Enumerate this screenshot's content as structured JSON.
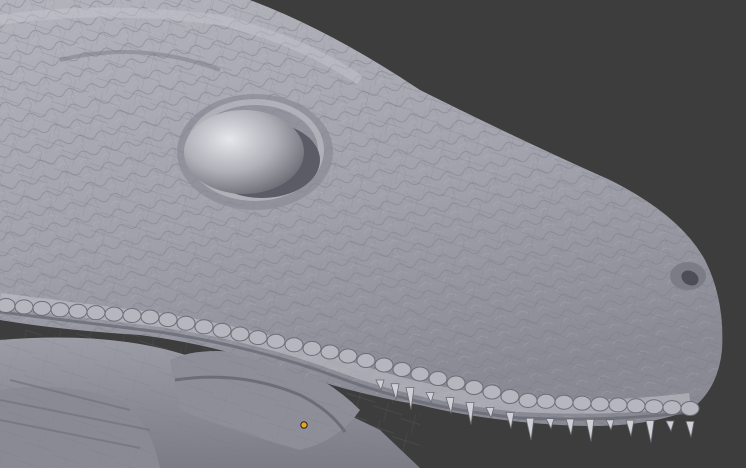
{
  "viewport": {
    "background_color": "#3d3d3d",
    "mesh_color": "#a3a3ad",
    "mesh_shadow_color": "#5e5e68",
    "mesh_highlight_color": "#d6d6de",
    "origin_point_color": "#f0a020"
  },
  "icons": {
    "origin": "object-origin-dot-icon"
  }
}
